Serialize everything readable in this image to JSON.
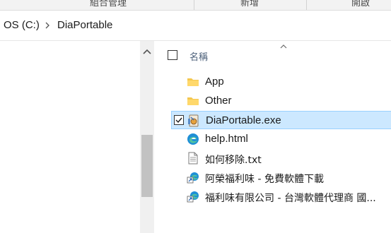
{
  "ribbon": {
    "groups": [
      "組合管理",
      "新增",
      "開啟"
    ]
  },
  "address": {
    "crumbs": [
      "OS (C:)",
      "DiaPortable"
    ]
  },
  "filelist": {
    "header_name": "名稱",
    "items": [
      {
        "name": "App",
        "icon": "folder-icon",
        "selected": false,
        "checked": false
      },
      {
        "name": "Other",
        "icon": "folder-icon",
        "selected": false,
        "checked": false
      },
      {
        "name": "DiaPortable.exe",
        "icon": "app-exe-icon",
        "selected": true,
        "checked": true
      },
      {
        "name": "help.html",
        "icon": "edge-browser-icon",
        "selected": false,
        "checked": false
      },
      {
        "name": "如何移除.txt",
        "icon": "text-file-icon",
        "selected": false,
        "checked": false
      },
      {
        "name": "阿榮福利味 - 免費軟體下載",
        "icon": "internet-shortcut-icon",
        "selected": false,
        "checked": false
      },
      {
        "name": "福利味有限公司 - 台灣軟體代理商 國...",
        "icon": "internet-shortcut-icon",
        "selected": false,
        "checked": false
      }
    ]
  },
  "colors": {
    "selection_bg": "#cce8ff",
    "selection_border": "#99d1ff",
    "folder": "#f4c74f",
    "edge": "#1f8fd6"
  }
}
